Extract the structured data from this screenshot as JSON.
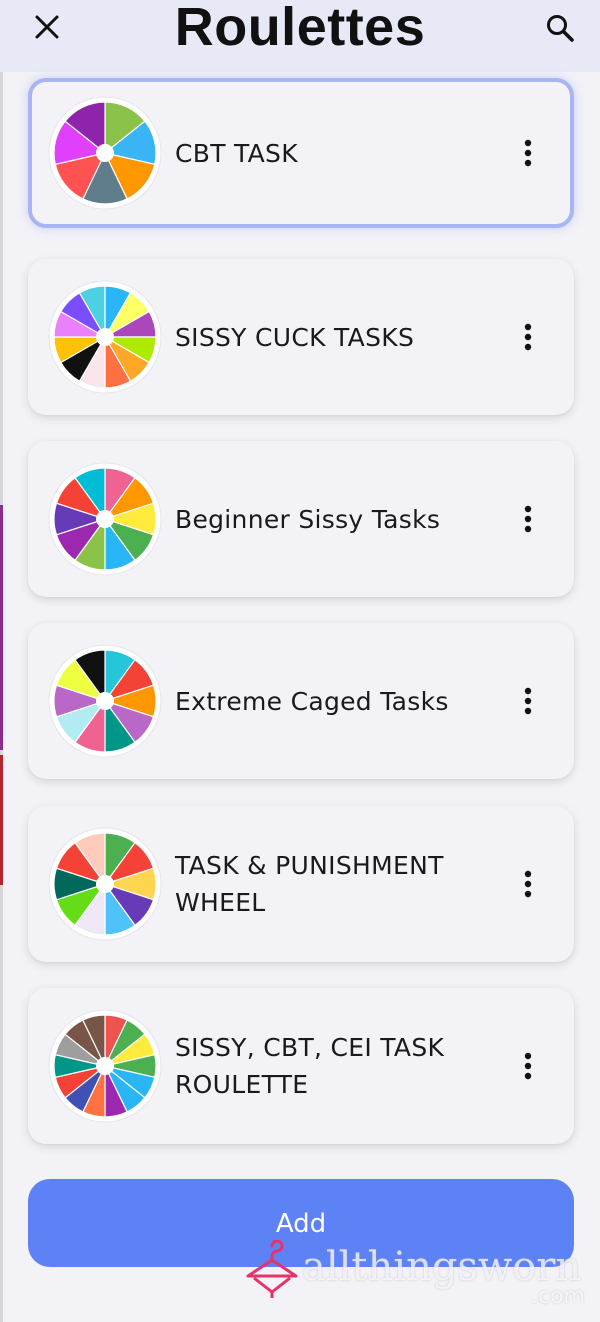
{
  "header": {
    "title": "Roulettes",
    "close_icon": "close-icon",
    "search_icon": "search-icon"
  },
  "roulettes": [
    {
      "label": "CBT TASK",
      "selected": true,
      "colors": [
        "#8bc34a",
        "#39b4f5",
        "#ff9800",
        "#607d8b",
        "#ff5252",
        "#e040fb",
        "#8e24aa"
      ]
    },
    {
      "label": "SISSY CUCK TASKS",
      "selected": false,
      "colors": [
        "#29b6f6",
        "#ffff66",
        "#ab47bc",
        "#aeea00",
        "#ffa726",
        "#ff7043",
        "#fce4ec",
        "#111111",
        "#ffc107",
        "#ea80fc",
        "#7c4dff",
        "#4dd0e1"
      ]
    },
    {
      "label": "Beginner Sissy Tasks",
      "selected": false,
      "colors": [
        "#f06292",
        "#ff9800",
        "#ffeb3b",
        "#4caf50",
        "#29b6f6",
        "#8bc34a",
        "#9c27b0",
        "#673ab7",
        "#f44336",
        "#00bcd4"
      ]
    },
    {
      "label": "Extreme Caged Tasks",
      "selected": false,
      "colors": [
        "#26c6da",
        "#f44336",
        "#ff9800",
        "#ba68c8",
        "#009688",
        "#f06292",
        "#b2ebf2",
        "#ba68c8",
        "#eeff41",
        "#111111"
      ]
    },
    {
      "label": "TASK & PUNISHMENT WHEEL",
      "selected": false,
      "colors": [
        "#4caf50",
        "#f44336",
        "#ffd54f",
        "#673ab7",
        "#4fc3f7",
        "#ede7f6",
        "#64dd17",
        "#00695c",
        "#f44336",
        "#ffccbc"
      ]
    },
    {
      "label": "SISSY, CBT, CEI TASK ROULETTE",
      "selected": false,
      "colors": [
        "#ef5350",
        "#4caf50",
        "#ffeb3b",
        "#4caf50",
        "#29b6f6",
        "#29b6f6",
        "#9c27b0",
        "#ff7043",
        "#3f51b5",
        "#f44336",
        "#009688",
        "#9e9e9e",
        "#795548",
        "#795548"
      ]
    }
  ],
  "add_button": {
    "label": "Add",
    "color": "#5c82f6"
  },
  "watermark": {
    "text": "allthingsworn",
    "suffix": ".com"
  },
  "icons": {
    "more": "more-vertical-icon"
  }
}
